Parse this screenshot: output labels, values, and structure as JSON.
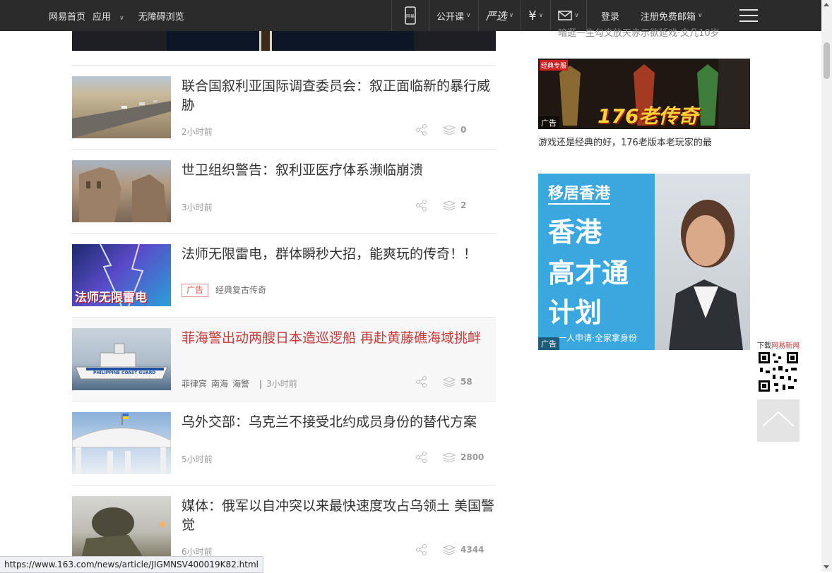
{
  "topbar": {
    "home": "网易首页",
    "apps": "应用",
    "accessible": "无障碍浏览",
    "mobile_news": "网易",
    "open_course": "公开课",
    "yanxuan": "严选",
    "pay": "¥",
    "login": "登录",
    "register_email": "注册免费邮箱"
  },
  "articles": [
    {
      "title": "联合国叙利亚国际调查委员会：叙正面临新的暴行威胁",
      "time": "2小时前",
      "comments": "0"
    },
    {
      "title": "世卫组织警告：叙利亚医疗体系濒临崩溃",
      "time": "3小时前",
      "comments": "2"
    },
    {
      "title": "法师无限雷电，群体瞬秒大招，能爽玩的传奇！！",
      "ad_tag": "广告",
      "ad_source": "经典复古传奇",
      "thumb_text_1": "法师无限雷电"
    },
    {
      "title": "菲海警出动两艘日本造巡逻船 再赴黄藤礁海域挑衅",
      "tags": [
        "菲律宾",
        "南海",
        "海警"
      ],
      "time": "3小时前",
      "comments": "58",
      "thumb_text": "PHILIPPINE COAST GUARD"
    },
    {
      "title": "乌外交部：乌克兰不接受北约成员身份的替代方案",
      "time": "5小时前",
      "comments": "2800"
    },
    {
      "title": "媒体：俄军以自冲突以来最快速度攻占乌领土 美国警觉",
      "time": "6小时前",
      "comments": "4344"
    }
  ],
  "sidebar": {
    "top_text": "暗逛一生勾文放天赤示欲延戏·文几10岁",
    "ad1": {
      "text": "176老传奇",
      "badge": "经典专服",
      "label": "广告",
      "caption": "游戏还是经典的好，176老版本老玩家的最"
    },
    "ad2": {
      "heading": "移居香港",
      "line1": "香港",
      "line2": "高才通",
      "line3": "计划",
      "footer": "一人申请·全家拿身份",
      "label": "广告"
    },
    "download_label_1": "下载",
    "download_label_2": "网易新闻"
  },
  "statusbar_url": "https://www.163.com/news/article/JIGMNSV400019K82.html",
  "colors": {
    "topbar": "#2b2b2b",
    "highlight_title": "#c8393a",
    "ad_blue": "#3aa8de"
  }
}
